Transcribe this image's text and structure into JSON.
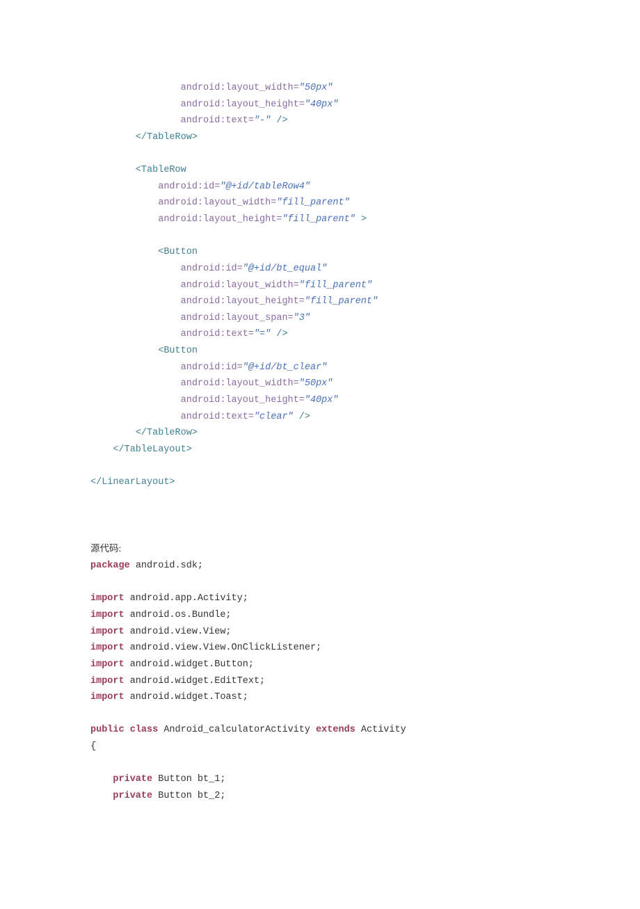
{
  "code": {
    "lines": [
      {
        "indent": 16,
        "frags": [
          {
            "cls": "attrname",
            "t": "android:layout_width"
          },
          {
            "cls": "attrname",
            "t": "="
          },
          {
            "cls": "strval",
            "t": "\"50px\""
          }
        ]
      },
      {
        "indent": 16,
        "frags": [
          {
            "cls": "attrname",
            "t": "android:layout_height"
          },
          {
            "cls": "attrname",
            "t": "="
          },
          {
            "cls": "strval",
            "t": "\"40px\""
          }
        ]
      },
      {
        "indent": 16,
        "frags": [
          {
            "cls": "attrname",
            "t": "android:text"
          },
          {
            "cls": "attrname",
            "t": "="
          },
          {
            "cls": "strval",
            "t": "\"-\""
          },
          {
            "cls": "tag",
            "t": " />"
          }
        ]
      },
      {
        "indent": 8,
        "frags": [
          {
            "cls": "tag",
            "t": "</TableRow>"
          }
        ]
      },
      {
        "indent": 0,
        "frags": []
      },
      {
        "indent": 8,
        "frags": [
          {
            "cls": "tag",
            "t": "<TableRow"
          }
        ]
      },
      {
        "indent": 12,
        "frags": [
          {
            "cls": "attrname",
            "t": "android:id"
          },
          {
            "cls": "attrname",
            "t": "="
          },
          {
            "cls": "strval",
            "t": "\"@+id/tableRow4\""
          }
        ]
      },
      {
        "indent": 12,
        "frags": [
          {
            "cls": "attrname",
            "t": "android:layout_width"
          },
          {
            "cls": "attrname",
            "t": "="
          },
          {
            "cls": "strval",
            "t": "\"fill_parent\""
          }
        ]
      },
      {
        "indent": 12,
        "frags": [
          {
            "cls": "attrname",
            "t": "android:layout_height"
          },
          {
            "cls": "attrname",
            "t": "="
          },
          {
            "cls": "strval",
            "t": "\"fill_parent\""
          },
          {
            "cls": "tag",
            "t": " >"
          }
        ]
      },
      {
        "indent": 0,
        "frags": []
      },
      {
        "indent": 12,
        "frags": [
          {
            "cls": "tag",
            "t": "<Button"
          }
        ]
      },
      {
        "indent": 16,
        "frags": [
          {
            "cls": "attrname",
            "t": "android:id"
          },
          {
            "cls": "attrname",
            "t": "="
          },
          {
            "cls": "strval",
            "t": "\"@+id/bt_equal\""
          }
        ]
      },
      {
        "indent": 16,
        "frags": [
          {
            "cls": "attrname",
            "t": "android:layout_width"
          },
          {
            "cls": "attrname",
            "t": "="
          },
          {
            "cls": "strval",
            "t": "\"fill_parent\""
          }
        ]
      },
      {
        "indent": 16,
        "frags": [
          {
            "cls": "attrname",
            "t": "android:layout_height"
          },
          {
            "cls": "attrname",
            "t": "="
          },
          {
            "cls": "strval",
            "t": "\"fill_parent\""
          }
        ]
      },
      {
        "indent": 16,
        "frags": [
          {
            "cls": "attrname",
            "t": "android:layout_span"
          },
          {
            "cls": "attrname",
            "t": "="
          },
          {
            "cls": "strval",
            "t": "\"3\""
          }
        ]
      },
      {
        "indent": 16,
        "frags": [
          {
            "cls": "attrname",
            "t": "android:text"
          },
          {
            "cls": "attrname",
            "t": "="
          },
          {
            "cls": "strval",
            "t": "\"=\""
          },
          {
            "cls": "tag",
            "t": " />"
          }
        ]
      },
      {
        "indent": 12,
        "frags": [
          {
            "cls": "tag",
            "t": "<Button"
          }
        ]
      },
      {
        "indent": 16,
        "frags": [
          {
            "cls": "attrname",
            "t": "android:id"
          },
          {
            "cls": "attrname",
            "t": "="
          },
          {
            "cls": "strval",
            "t": "\"@+id/bt_clear\""
          }
        ]
      },
      {
        "indent": 16,
        "frags": [
          {
            "cls": "attrname",
            "t": "android:layout_width"
          },
          {
            "cls": "attrname",
            "t": "="
          },
          {
            "cls": "strval",
            "t": "\"50px\""
          }
        ]
      },
      {
        "indent": 16,
        "frags": [
          {
            "cls": "attrname",
            "t": "android:layout_height"
          },
          {
            "cls": "attrname",
            "t": "="
          },
          {
            "cls": "strval",
            "t": "\"40px\""
          }
        ]
      },
      {
        "indent": 16,
        "frags": [
          {
            "cls": "attrname",
            "t": "android:text"
          },
          {
            "cls": "attrname",
            "t": "="
          },
          {
            "cls": "strval",
            "t": "\"clear\""
          },
          {
            "cls": "tag",
            "t": " />"
          }
        ]
      },
      {
        "indent": 8,
        "frags": [
          {
            "cls": "tag",
            "t": "</TableRow>"
          }
        ]
      },
      {
        "indent": 4,
        "frags": [
          {
            "cls": "tag",
            "t": "</TableLayout>"
          }
        ]
      },
      {
        "indent": 0,
        "frags": []
      },
      {
        "indent": 0,
        "frags": [
          {
            "cls": "tag",
            "t": "</LinearLayout>"
          }
        ]
      },
      {
        "indent": 0,
        "frags": []
      },
      {
        "indent": 0,
        "frags": []
      },
      {
        "indent": 0,
        "frags": []
      },
      {
        "indent": 0,
        "frags": [
          {
            "cls": "plain cjk",
            "t": "源代码:"
          }
        ]
      },
      {
        "indent": 0,
        "frags": [
          {
            "cls": "kw",
            "t": "package"
          },
          {
            "cls": "plain",
            "t": " android.sdk;"
          }
        ]
      },
      {
        "indent": 0,
        "frags": []
      },
      {
        "indent": 0,
        "frags": [
          {
            "cls": "kw",
            "t": "import"
          },
          {
            "cls": "plain",
            "t": " android.app.Activity;"
          }
        ]
      },
      {
        "indent": 0,
        "frags": [
          {
            "cls": "kw",
            "t": "import"
          },
          {
            "cls": "plain",
            "t": " android.os.Bundle;"
          }
        ]
      },
      {
        "indent": 0,
        "frags": [
          {
            "cls": "kw",
            "t": "import"
          },
          {
            "cls": "plain",
            "t": " android.view.View;"
          }
        ]
      },
      {
        "indent": 0,
        "frags": [
          {
            "cls": "kw",
            "t": "import"
          },
          {
            "cls": "plain",
            "t": " android.view.View.OnClickListener;"
          }
        ]
      },
      {
        "indent": 0,
        "frags": [
          {
            "cls": "kw",
            "t": "import"
          },
          {
            "cls": "plain",
            "t": " android.widget.Button;"
          }
        ]
      },
      {
        "indent": 0,
        "frags": [
          {
            "cls": "kw",
            "t": "import"
          },
          {
            "cls": "plain",
            "t": " android.widget.EditText;"
          }
        ]
      },
      {
        "indent": 0,
        "frags": [
          {
            "cls": "kw",
            "t": "import"
          },
          {
            "cls": "plain",
            "t": " android.widget.Toast;"
          }
        ]
      },
      {
        "indent": 0,
        "frags": []
      },
      {
        "indent": 0,
        "frags": [
          {
            "cls": "kw",
            "t": "public"
          },
          {
            "cls": "plain",
            "t": " "
          },
          {
            "cls": "kw",
            "t": "class"
          },
          {
            "cls": "plain",
            "t": " Android_calculatorActivity "
          },
          {
            "cls": "kw",
            "t": "extends"
          },
          {
            "cls": "plain",
            "t": " Activity"
          }
        ]
      },
      {
        "indent": 0,
        "frags": [
          {
            "cls": "plain",
            "t": "{"
          }
        ]
      },
      {
        "indent": 0,
        "frags": []
      },
      {
        "indent": 4,
        "frags": [
          {
            "cls": "kw",
            "t": "private"
          },
          {
            "cls": "plain",
            "t": " Button bt_1;"
          }
        ]
      },
      {
        "indent": 4,
        "frags": [
          {
            "cls": "kw",
            "t": "private"
          },
          {
            "cls": "plain",
            "t": " Button bt_2;"
          }
        ]
      }
    ]
  }
}
